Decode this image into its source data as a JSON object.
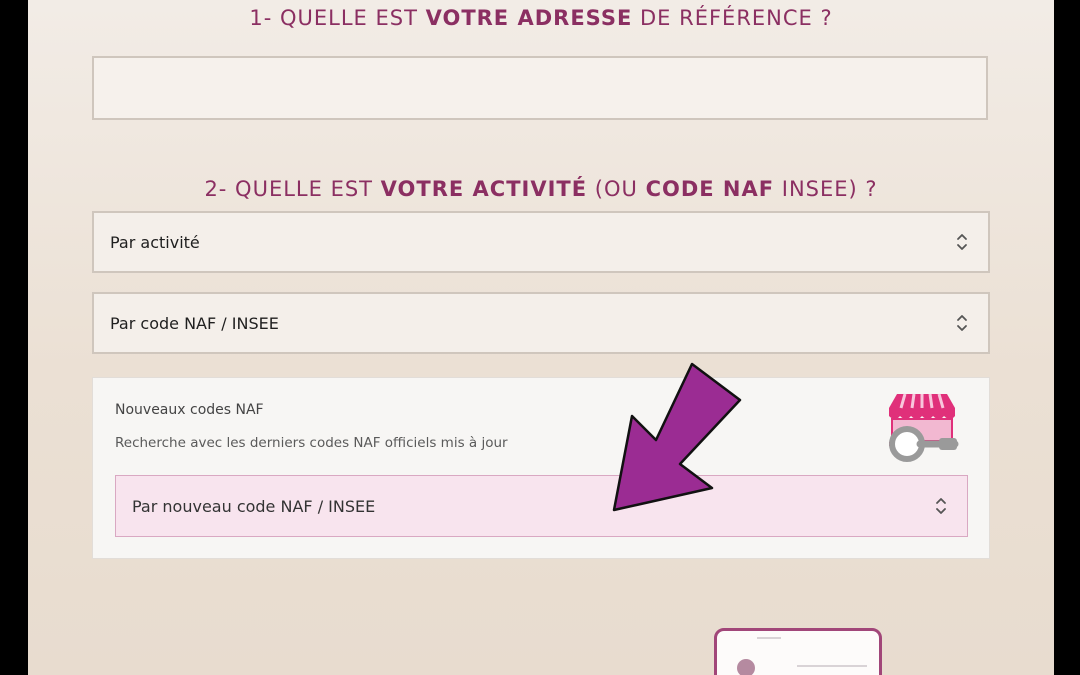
{
  "question1": {
    "prefix": "1- QUELLE EST ",
    "bold": "VOTRE ADRESSE",
    "suffix": " DE RÉFÉRENCE ?"
  },
  "address_input": {
    "value": "",
    "placeholder": ""
  },
  "question2": {
    "prefix": "2- QUELLE EST ",
    "bold1": "VOTRE ACTIVITÉ",
    "middle": " (OU ",
    "bold2": "CODE NAF",
    "suffix": " INSEE) ?"
  },
  "select_activity": {
    "value": "Par activité"
  },
  "select_naf": {
    "value": "Par code NAF / INSEE"
  },
  "naf_panel": {
    "title": "Nouveaux codes NAF",
    "subtitle": "Recherche avec les derniers codes NAF officiels mis à jour",
    "select_value": "Par nouveau code NAF / INSEE"
  },
  "icons": {
    "chevron": "chevron-updown-icon",
    "shop": "shop-search-icon",
    "arrow": "pointer-arrow-icon"
  },
  "colors": {
    "accent": "#8b2f62",
    "arrow_fill": "#9b2c93",
    "shop_pink": "#e0307a",
    "highlight_bg": "#f8e4ee"
  }
}
